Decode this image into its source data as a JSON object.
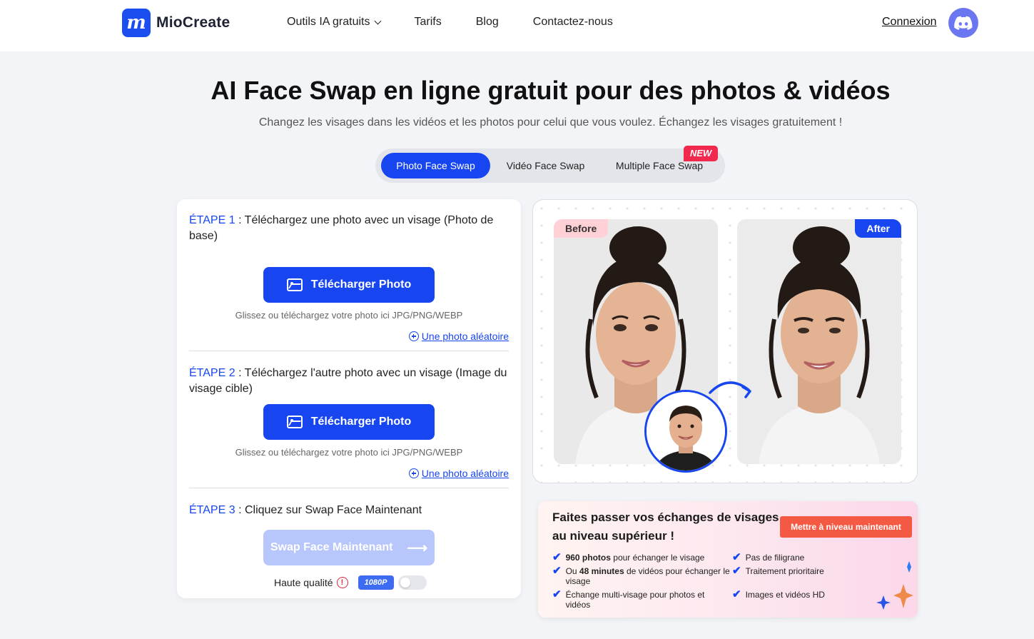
{
  "header": {
    "brand": "MioCreate",
    "logo_letter": "m",
    "nav": [
      {
        "label": "Outils IA gratuits",
        "has_dropdown": true
      },
      {
        "label": "Tarifs"
      },
      {
        "label": "Blog"
      },
      {
        "label": "Contactez-nous"
      }
    ],
    "login_label": "Connexion",
    "discord_icon": "discord-icon"
  },
  "hero": {
    "title": "AI Face Swap en ligne gratuit pour des photos & vidéos",
    "subtitle": "Changez les visages dans les vidéos et les photos pour celui que vous voulez. Échangez les visages gratuitement !"
  },
  "tabs": [
    {
      "label": "Photo Face Swap",
      "active": true
    },
    {
      "label": "Vidéo Face Swap",
      "active": false
    },
    {
      "label": "Multiple Face Swap",
      "active": false
    }
  ],
  "new_badge": "NEW",
  "steps": [
    {
      "label": "ÉTAPE 1",
      "text": " : Téléchargez une photo avec un visage (Photo de base)",
      "button": "Télécharger Photo",
      "hint": "Glissez ou téléchargez votre photo ici JPG/PNG/WEBP",
      "random_link": "Une photo aléatoire"
    },
    {
      "label": "ÉTAPE 2",
      "text": " : Téléchargez l'autre photo avec un visage (Image du visage cible)",
      "button": "Télécharger Photo",
      "hint": "Glissez ou téléchargez votre photo ici JPG/PNG/WEBP",
      "random_link": "Une photo aléatoire"
    },
    {
      "label": "ÉTAPE 3",
      "text": " : Cliquez sur Swap Face Maintenant",
      "button": "Swap Face Maintenant"
    }
  ],
  "quality": {
    "label": "Haute qualité",
    "resolution": "1080P",
    "enabled": false
  },
  "preview": {
    "before_label": "Before",
    "after_label": "After"
  },
  "promo": {
    "title": "Faites passer vos échanges de visages au niveau supérieur !",
    "button": "Mettre à niveau maintenant",
    "features_left": [
      {
        "bold": "960 photos",
        "text": " pour échanger le visage"
      },
      {
        "pre": "Ou ",
        "bold": "48 minutes",
        "text": " de vidéos pour échanger le visage"
      },
      {
        "bold": "",
        "text": "Échange multi-visage pour photos et vidéos"
      }
    ],
    "features_right": [
      "Pas de filigrane",
      "Traitement prioritaire",
      "Images et vidéos HD"
    ]
  },
  "colors": {
    "primary": "#1746f0",
    "accent_red": "#f0294d",
    "promo_button": "#f45a43"
  }
}
